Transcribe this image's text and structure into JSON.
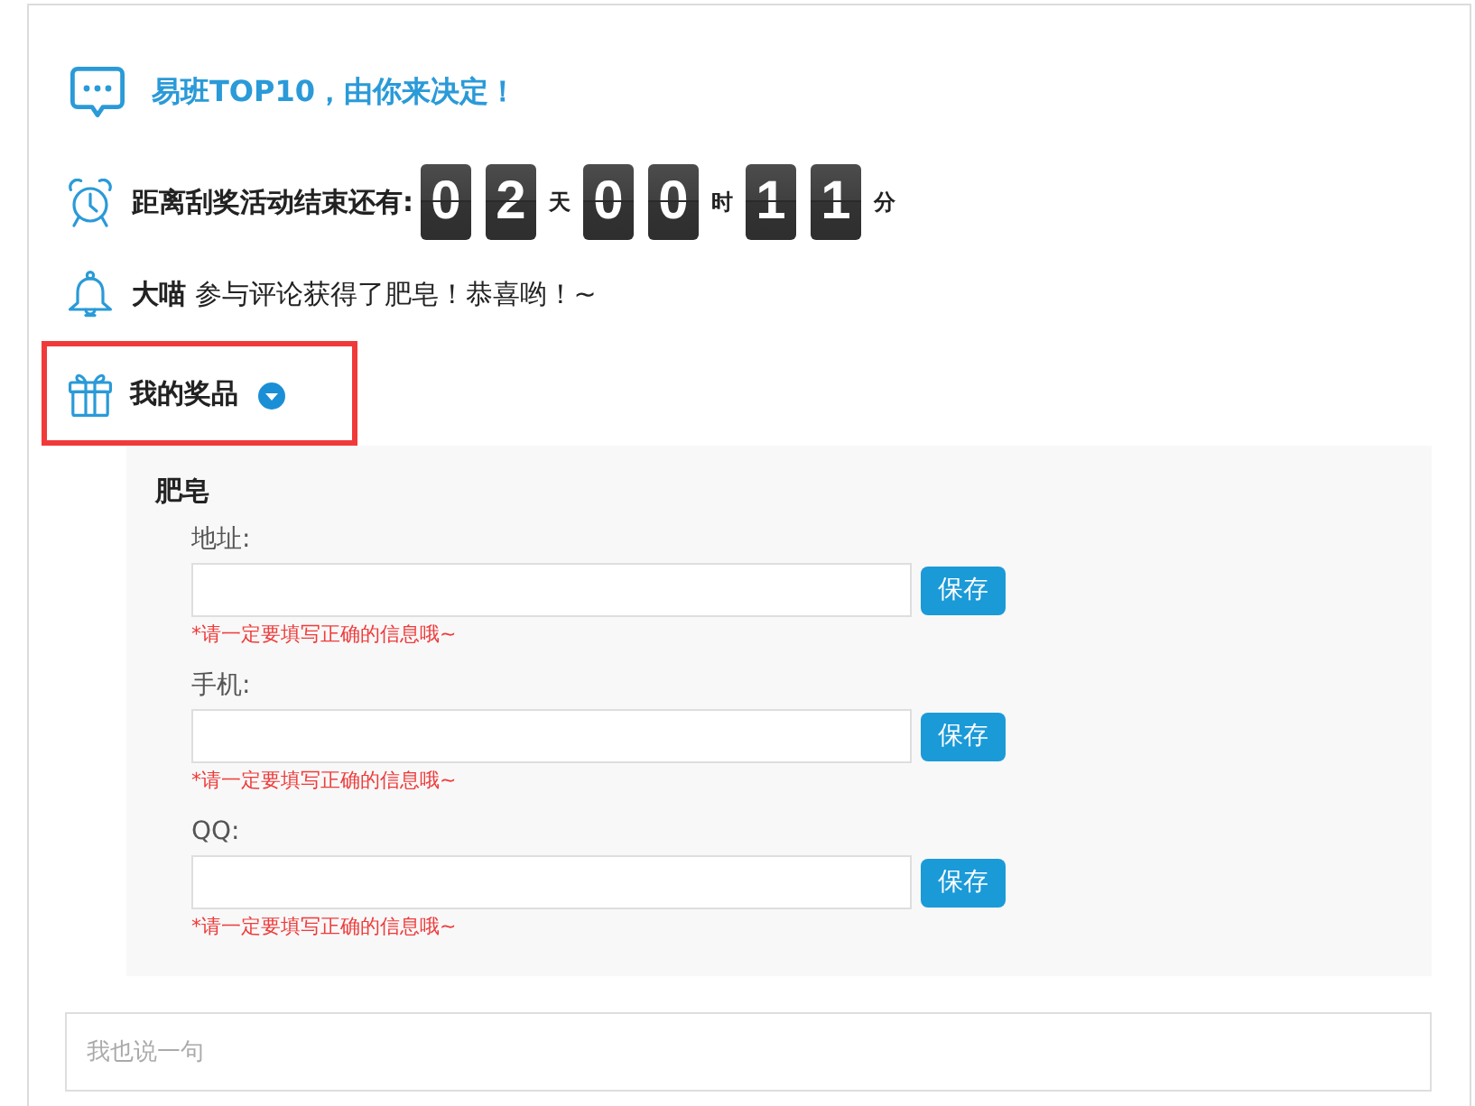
{
  "header": {
    "title": "易班TOP10，由你来决定！"
  },
  "countdown": {
    "label": "距离刮奖活动结束还有:",
    "units": [
      {
        "digits": [
          "0",
          "2"
        ],
        "label": "天"
      },
      {
        "digits": [
          "0",
          "0"
        ],
        "label": "时"
      },
      {
        "digits": [
          "1",
          "1"
        ],
        "label": "分"
      }
    ]
  },
  "notice": {
    "message": "**大喵** 参与评论获得了肥皂！恭喜哟！~"
  },
  "prizes": {
    "title": "我的奖品",
    "expanded": true,
    "highlighted": true,
    "items": [
      {
        "name": "肥皂",
        "fields": [
          {
            "label": "地址:",
            "button": "保存",
            "hint": "*请一定要填写正确的信息哦~"
          },
          {
            "label": "手机:",
            "button": "保存",
            "hint": "*请一定要填写正确的信息哦~"
          },
          {
            "label": "QQ:",
            "button": "保存",
            "hint": "*请一定要填写正确的信息哦~"
          }
        ]
      }
    ]
  },
  "comment": {
    "placeholder": "我也说一句"
  }
}
